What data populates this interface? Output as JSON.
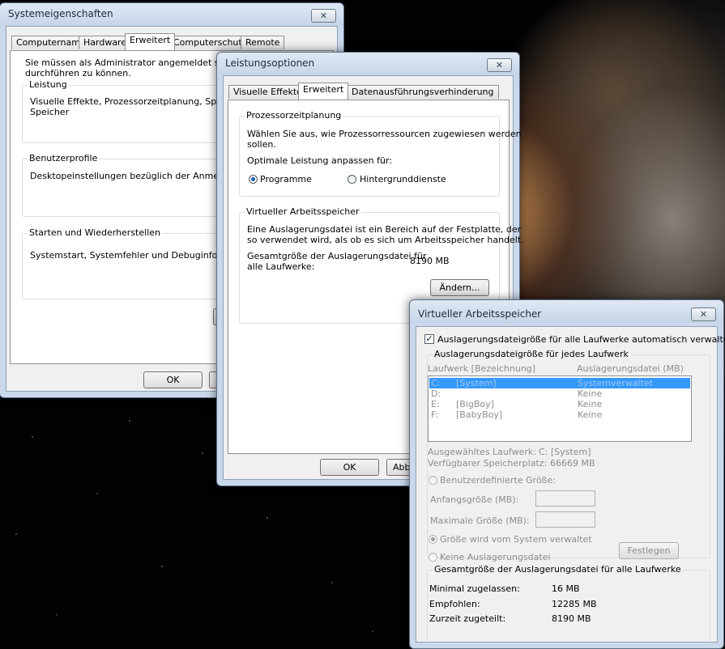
{
  "system_properties": {
    "title": "Systemeigenschaften",
    "close": "✕",
    "tabs": [
      "Computername",
      "Hardware",
      "Erweitert",
      "Computerschutz",
      "Remote"
    ],
    "admin_notice": [
      "Sie müssen als Administrator angemeldet sein, um",
      "durchführen zu können."
    ],
    "groups": [
      {
        "label": "Leistung",
        "text": [
          "Visuelle Effekte, Prozessorzeitplanung, Speicher",
          "Speicher"
        ]
      },
      {
        "label": "Benutzerprofile",
        "text": [
          "Desktopeinstellungen bezüglich der Anmeldung"
        ]
      },
      {
        "label": "Starten und Wiederherstellen",
        "text": [
          "Systemstart, Systemfehler und Debuginformatione"
        ]
      }
    ],
    "ok": "OK"
  },
  "performance_options": {
    "title": "Leistungsoptionen",
    "close": "✕",
    "tabs": [
      "Visuelle Effekte",
      "Erweitert",
      "Datenausführungsverhinderung"
    ],
    "scheduling": {
      "label": "Prozessorzeitplanung",
      "description": [
        "Wählen Sie aus, wie Prozessorressourcen zugewiesen werden",
        "sollen."
      ],
      "adjust_label": "Optimale Leistung anpassen für:",
      "option_programs": "Programme",
      "option_background": "Hintergrunddienste"
    },
    "virtual_memory": {
      "label": "Virtueller Arbeitsspeicher",
      "description": [
        "Eine Auslagerungsdatei ist ein Bereich auf der Festplatte, der",
        "so verwendet wird, als ob es sich um Arbeitsspeicher handelt."
      ],
      "total_label": [
        "Gesamtgröße der Auslagerungsdatei für",
        "alle Laufwerke:"
      ],
      "total_value": "8190 MB",
      "change_button": "Ändern..."
    },
    "ok": "OK",
    "cancel_partial": "Abb"
  },
  "virtual_memory_dialog": {
    "title": "Virtueller Arbeitsspeicher",
    "close": "✕",
    "auto_manage": "Auslagerungsdateigröße für alle Laufwerke automatisch verwalten",
    "auto_checked": "✓",
    "per_drive": {
      "label": "Auslagerungsdateigröße für jedes Laufwerk",
      "col_drive": "Laufwerk [Bezeichnung]",
      "col_pagefile": "Auslagerungsdatei (MB)",
      "drives": [
        {
          "drive": "C:",
          "name": "[System]",
          "pagefile": "Systemverwaltet"
        },
        {
          "drive": "D:",
          "name": "",
          "pagefile": "Keine"
        },
        {
          "drive": "E:",
          "name": "[BigBoy]",
          "pagefile": "Keine"
        },
        {
          "drive": "F:",
          "name": "[BabyBoy]",
          "pagefile": "Keine"
        }
      ],
      "selected_drive_label": "Ausgewähltes Laufwerk:",
      "selected_drive_value": "C:  [System]",
      "free_space_label": "Verfügbarer Speicherplatz:",
      "free_space_value": "66669 MB",
      "custom_size": "Benutzerdefinierte Größe:",
      "initial_size": "Anfangsgröße (MB):",
      "max_size": "Maximale Größe (MB):",
      "system_managed": "Größe wird vom System verwaltet",
      "no_pagefile": "Keine Auslagerungsdatei",
      "set_button": "Festlegen"
    },
    "totals": {
      "label": "Gesamtgröße der Auslagerungsdatei für alle Laufwerke",
      "min_label": "Minimal zugelassen:",
      "min_value": "16 MB",
      "recommended_label": "Empfohlen:",
      "recommended_value": "12285 MB",
      "allocated_label": "Zurzeit zugeteilt:",
      "allocated_value": "8190 MB"
    }
  }
}
